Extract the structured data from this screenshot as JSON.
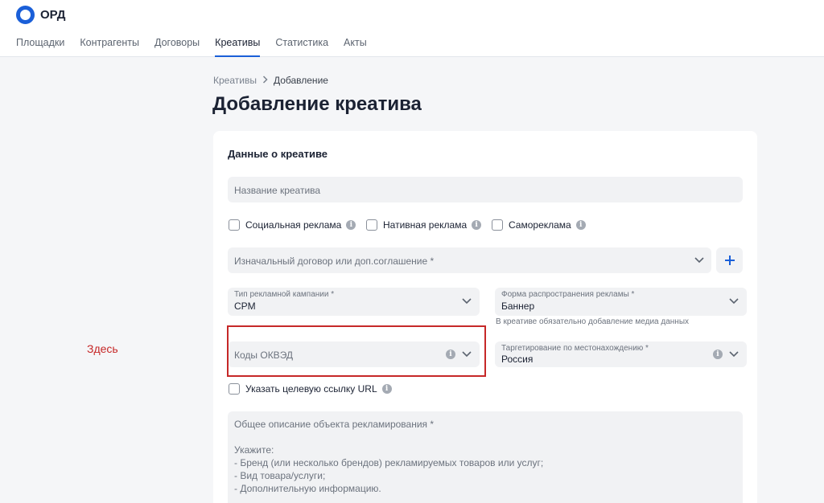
{
  "app": {
    "logo_text": "ОРД"
  },
  "nav": {
    "items": [
      {
        "label": "Площадки"
      },
      {
        "label": "Контрагенты"
      },
      {
        "label": "Договоры"
      },
      {
        "label": "Креативы"
      },
      {
        "label": "Статистика"
      },
      {
        "label": "Акты"
      }
    ],
    "active": "Креативы"
  },
  "breadcrumb": {
    "parent": "Креативы",
    "current": "Добавление"
  },
  "page": {
    "title": "Добавление креатива"
  },
  "form": {
    "section_title": "Данные о креативе",
    "name_placeholder": "Название креатива",
    "checkboxes": [
      {
        "label": "Социальная реклама",
        "checked": false
      },
      {
        "label": "Нативная реклама",
        "checked": false
      },
      {
        "label": "Самореклама",
        "checked": false
      }
    ],
    "contract_placeholder": "Изначальный договор или доп.соглашение *",
    "campaign_type": {
      "label": "Тип рекламной кампании *",
      "value": "CPM"
    },
    "distribution_form": {
      "label": "Форма распространения рекламы *",
      "value": "Баннер",
      "hint": "В креативе обязательно добавление медиа данных"
    },
    "okved_placeholder": "Коды ОКВЭД",
    "targeting": {
      "label": "Таргетирование по местонахождению *",
      "value": "Россия"
    },
    "url_checkbox": {
      "label": "Указать целевую ссылку URL",
      "checked": false
    },
    "description_placeholder": [
      "Общее описание объекта рекламирования *",
      "",
      "Укажите:",
      "- Бренд (или несколько брендов) рекламируемых товаров или услуг;",
      "- Вид товара/услуги;",
      "- Дополнительную информацию."
    ]
  },
  "annotation": {
    "note": "Здесь"
  },
  "colors": {
    "accent": "#1a5fd8",
    "annotation": "#c62828"
  }
}
